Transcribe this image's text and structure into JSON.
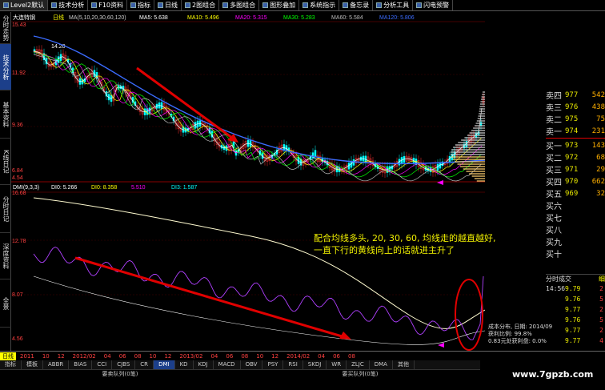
{
  "menu": {
    "items": [
      "Level2默认",
      "技术分析",
      "F10资料",
      "指标",
      "日线",
      "2图组合",
      "多图组合",
      "图形叠加",
      "系统指示",
      "备忘录",
      "分析工具",
      "闪电预警"
    ]
  },
  "left_tabs": [
    "分时走势",
    "技术分析",
    "基本资料",
    "K线日记",
    "分时日记",
    "深度资料",
    "全景"
  ],
  "chart": {
    "stock_name": "大连特钢",
    "period_label": "日线",
    "ma_header": "MA(5,10,20,30,60,120)",
    "ma_values": [
      {
        "label": "MA5:",
        "value": "5.638",
        "color": "#ffffff"
      },
      {
        "label": "MA10:",
        "value": "5.496",
        "color": "#ffff00"
      },
      {
        "label": "MA20:",
        "value": "5.315",
        "color": "#ff00ff"
      },
      {
        "label": "MA30:",
        "value": "5.283",
        "color": "#00ff00"
      },
      {
        "label": "MA60:",
        "value": "5.584",
        "color": "#bbbbbb"
      },
      {
        "label": "MA120:",
        "value": "5.806",
        "color": "#3b6cff"
      }
    ],
    "y_labels_top": [
      "15.43",
      "11.92",
      "9.36",
      "6.84",
      "4.54"
    ],
    "high_marker": "14.20",
    "indicator_header": "DMI(9,3,3)",
    "indicator_values": [
      {
        "label": "DI0:",
        "value": "5.266",
        "color": "#ffffff"
      },
      {
        "label": "DI0:",
        "value": "8.358",
        "color": "#ffff00"
      },
      {
        "label": "",
        "value": "5.510",
        "color": "#ff00ff"
      },
      {
        "label": "DI3:",
        "value": "1.587",
        "color": "#00ffff"
      }
    ],
    "y_labels_bottom": [
      "16.68",
      "12.78",
      "8.07",
      "4.56"
    ],
    "date_labels": [
      "2011",
      "10",
      "12",
      "2012/02",
      "04",
      "06",
      "08",
      "10",
      "12",
      "2013/02",
      "04",
      "06",
      "08",
      "10",
      "12",
      "2014/02",
      "04",
      "06",
      "08"
    ]
  },
  "annotation": {
    "line1": "配合均线多头, 20, 30, 60, 均线走的越直越好,",
    "line2": "一直下行的黄线向上的话就进主升了"
  },
  "order_book": {
    "sells": [
      {
        "label": "卖四",
        "price": "977",
        "vol": "542"
      },
      {
        "label": "卖三",
        "price": "976",
        "vol": "438"
      },
      {
        "label": "卖二",
        "price": "975",
        "vol": "75"
      },
      {
        "label": "卖一",
        "price": "974",
        "vol": "231"
      }
    ],
    "buys": [
      {
        "label": "买一",
        "price": "973",
        "vol": "143"
      },
      {
        "label": "买二",
        "price": "972",
        "vol": "68"
      },
      {
        "label": "买三",
        "price": "971",
        "vol": "29"
      },
      {
        "label": "买四",
        "price": "970",
        "vol": "662"
      },
      {
        "label": "买五",
        "price": "969",
        "vol": "32"
      },
      {
        "label": "买六",
        "price": "",
        "vol": ""
      },
      {
        "label": "买七",
        "price": "",
        "vol": ""
      },
      {
        "label": "买八",
        "price": "",
        "vol": ""
      },
      {
        "label": "买九",
        "price": "",
        "vol": ""
      },
      {
        "label": "买十",
        "price": "",
        "vol": ""
      }
    ],
    "trades_title": "分时成交",
    "trades_more": "细",
    "trades": [
      {
        "time": "14:56",
        "price": "9.79",
        "vol": "2"
      },
      {
        "time": "",
        "price": "9.76",
        "vol": "5"
      },
      {
        "time": "",
        "price": "9.77",
        "vol": "2"
      },
      {
        "time": "",
        "price": "9.76",
        "vol": "5"
      },
      {
        "time": "",
        "price": "9.77",
        "vol": "2"
      },
      {
        "time": "",
        "price": "9.77",
        "vol": "4"
      }
    ]
  },
  "cost_info": {
    "line1": "成本分布, 日期: 2014/09",
    "line2": "获利比例: 99.8%",
    "line3": "0.83元处获利盘: 0.0%"
  },
  "status": {
    "label": "日线",
    "items": [
      "2011",
      "10",
      "12",
      "2012/02",
      "04",
      "06",
      "08",
      "10",
      "12",
      "2013/02",
      "04",
      "06",
      "08",
      "10",
      "12",
      "2014/02",
      "04",
      "06",
      "08"
    ]
  },
  "indicator_tabs": {
    "items": [
      "指标",
      "模板",
      "ABBR",
      "BIAS",
      "CCI",
      "CJBS",
      "CR",
      "DMI",
      "KD",
      "KDJ",
      "MACD",
      "OBV",
      "PSY",
      "RSI",
      "SKDJ",
      "WR",
      "ZLJC",
      "DMA",
      "其他"
    ],
    "active": "DMI"
  },
  "queue": {
    "left": "要卖队列(0笔)",
    "right": "要买队列(0笔)"
  },
  "watermark": "www.7gpzb.com",
  "colors": {
    "up": "#ff3030",
    "down": "#00ffff",
    "arrow": "#e00000",
    "accent": "#1c3f8a"
  }
}
